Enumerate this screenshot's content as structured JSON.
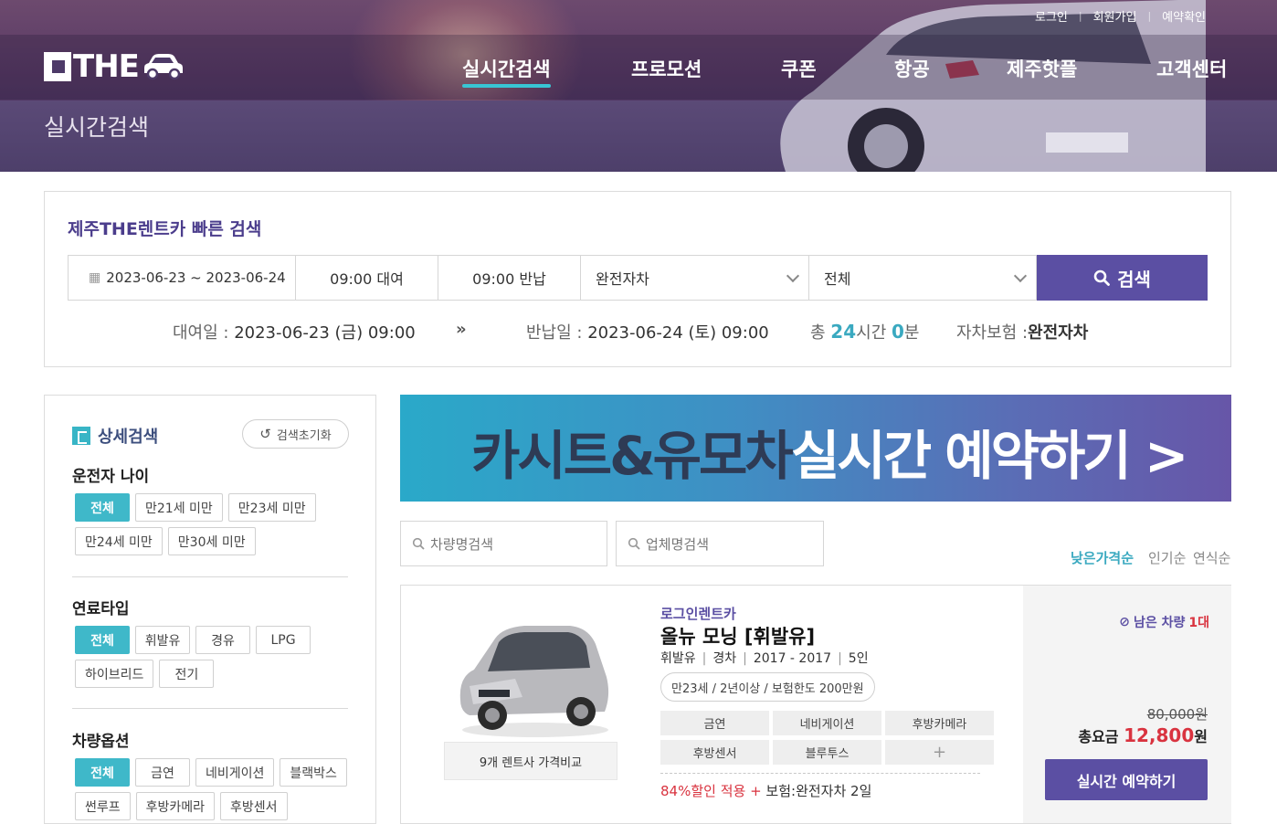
{
  "header": {
    "top_links": [
      "로그인",
      "회원가입",
      "예약확인"
    ],
    "logo_text": "THE",
    "nav": [
      "실시간검색",
      "프로모션",
      "쿠폰",
      "항공",
      "제주핫플",
      "고객센터"
    ],
    "page_heading": "실시간검색",
    "accent_color": "#38c6d4"
  },
  "quick_search": {
    "title": "제주THE렌트카 빠른 검색",
    "date_range": "2023-06-23 ~ 2023-06-24",
    "pickup_time": "09:00 대여",
    "return_time": "09:00 반납",
    "insurance_select": "완전자차",
    "type_select": "전체",
    "search_button": "검색",
    "summary": {
      "rent_label": "대여일 :",
      "rent_value": "2023-06-23 (금)  09:00",
      "arrow": "»",
      "return_label": "반납일 :",
      "return_value": "2023-06-24 (토)  09:00",
      "total_prefix": "총 ",
      "hours": "24",
      "hours_unit": "시간 ",
      "minutes": "0",
      "minutes_unit": "분",
      "ins_label": "자차보험 :",
      "ins_value": "완전자차"
    }
  },
  "sidebar": {
    "title": "상세검색",
    "reset": "검색초기화",
    "groups": [
      {
        "title": "운전자 나이",
        "options": [
          "전체",
          "만21세 미만",
          "만23세 미만",
          "만24세 미만",
          "만30세 미만"
        ],
        "selected": "전체"
      },
      {
        "title": "연료타입",
        "options": [
          "전체",
          "휘발유",
          "경유",
          "LPG",
          "하이브리드",
          "전기"
        ],
        "selected": "전체"
      },
      {
        "title": "차량옵션",
        "options": [
          "전체",
          "금연",
          "네비게이션",
          "블랙박스",
          "썬루프",
          "후방카메라",
          "후방센서"
        ],
        "selected": "전체"
      }
    ]
  },
  "banner": {
    "dark": "카시트&유모차",
    "light": "실시간 예약하기 >"
  },
  "filters": {
    "car_search_placeholder": "차량명검색",
    "company_search_placeholder": "업체명검색",
    "sort": [
      "낮은가격순",
      "인기순",
      "연식순"
    ],
    "sort_active": "낮은가격순"
  },
  "car": {
    "company": "로그인렌트카",
    "model": "올뉴 모닝 [휘발유]",
    "specs": [
      "휘발유",
      "경차",
      "2017 - 2017",
      "5인"
    ],
    "conditions": "만23세 / 2년이상 / 보험한도 200만원",
    "options": [
      "금연",
      "네비게이션",
      "후방카메라",
      "후방센서",
      "블루투스",
      "+"
    ],
    "discount": "84%할인 적용",
    "discount_plus": " + ",
    "insurance": "보험:완전자차 2일",
    "compare": "9개 렌트사 가격비교",
    "remaining_label": "남은 차량",
    "remaining_count": "1대",
    "original_price": "80,000원",
    "total_label": "총요금 ",
    "total_price": "12,800",
    "total_unit": "원",
    "book_button": "실시간 예약하기"
  }
}
